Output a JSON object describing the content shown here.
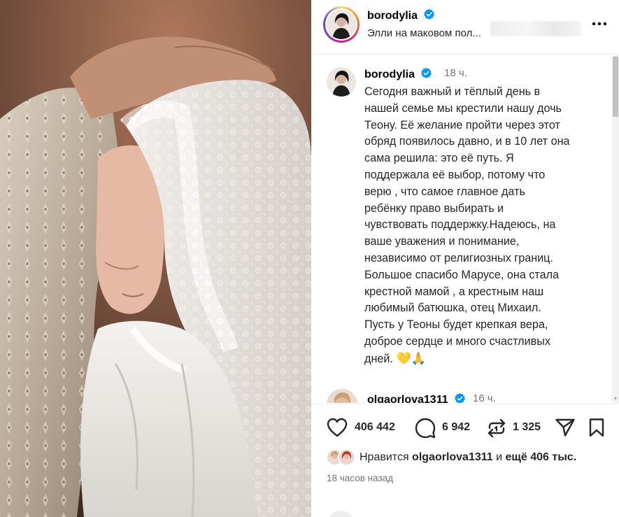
{
  "post": {
    "author": {
      "username": "borodylia",
      "verified": true,
      "subtitle": "Элли на маковом пол..."
    },
    "caption": {
      "username": "borodylia",
      "time": "18 ч.",
      "text": "Сегодня важный и тёплый день в\nнашей семье мы крестили нашу дочь\nТеону. Её желание пройти через этот\nобряд появилось давно, и в 10 лет она\nсама решила: это её путь. Я\nподдержала её выбор, потому что\nверю , что самое главное дать\nребёнку право выбирать и\nчувствовать поддержку.Надеюсь, на\nваше уважения и понимание,\nнезависимо от религиозных границ.\nБольшое спасибо Марусе, она стала\nкрестной мамой , а крестным наш\nлюбимый батюшка, отец Михаил.\nПусть у Теоны будет крепкая вера,\nдоброе сердце и много счастливых\nдней.",
      "emojis": "💛🙏"
    },
    "comment": {
      "username": "olgaorlova1311",
      "verified": true,
      "time": "16 ч."
    },
    "actions": {
      "likes_count": "406 442",
      "comments_count": "6 942",
      "reposts_count": "1 325"
    },
    "likes_summary": {
      "prefix": "Нравится ",
      "user": "olgaorlova1311",
      "middle": " и ",
      "rest": "ещё 406 тыс."
    },
    "timestamp": "18 часов назад"
  },
  "icons": {
    "like": "heart-icon",
    "comment": "comment-bubble-icon",
    "repost": "repost-icon",
    "share": "paper-plane-icon",
    "save": "bookmark-icon",
    "more": "more-dots-icon",
    "verified": "verified-badge-icon"
  },
  "colors": {
    "verified": "#0095f6",
    "text": "#262626",
    "secondary": "#737373"
  }
}
